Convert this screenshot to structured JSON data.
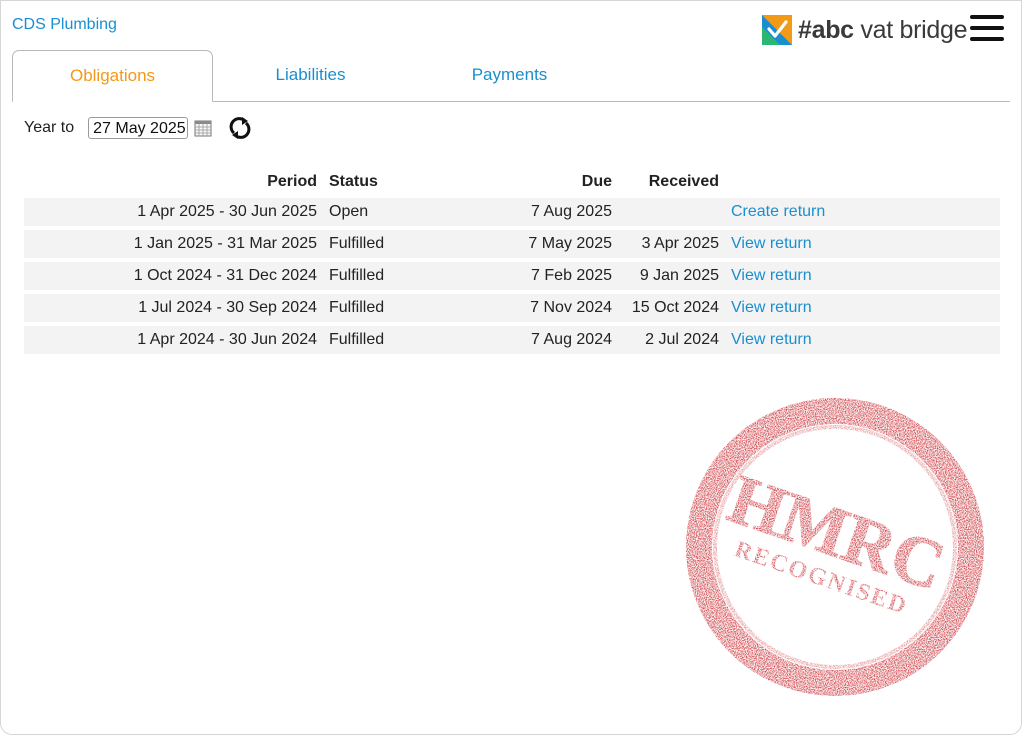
{
  "header": {
    "company": "CDS Plumbing",
    "logo": {
      "hash": "#",
      "abc": "abc",
      "rest": " vat bridge"
    },
    "menu_icon": "hamburger-menu-icon"
  },
  "tabs": [
    {
      "label": "Obligations",
      "active": true
    },
    {
      "label": "Liabilities",
      "active": false
    },
    {
      "label": "Payments",
      "active": false
    }
  ],
  "filter": {
    "year_label": "Year to",
    "year_value": "27 May 2025",
    "calendar_icon": "calendar-icon",
    "refresh_icon": "refresh-icon"
  },
  "table": {
    "columns": [
      "Period",
      "Status",
      "Due",
      "Received",
      ""
    ],
    "rows": [
      {
        "period": "1 Apr 2025 - 30 Jun 2025",
        "status": "Open",
        "due": "7 Aug 2025",
        "received": "",
        "action": "Create return"
      },
      {
        "period": "1 Jan 2025 - 31 Mar 2025",
        "status": "Fulfilled",
        "due": "7 May 2025",
        "received": "3 Apr 2025",
        "action": "View return"
      },
      {
        "period": "1 Oct 2024 - 31 Dec 2024",
        "status": "Fulfilled",
        "due": "7 Feb 2025",
        "received": "9 Jan 2025",
        "action": "View return"
      },
      {
        "period": "1 Jul 2024 - 30 Sep 2024",
        "status": "Fulfilled",
        "due": "7 Nov 2024",
        "received": "15 Oct 2024",
        "action": "View return"
      },
      {
        "period": "1 Apr 2024 - 30 Jun 2024",
        "status": "Fulfilled",
        "due": "7 Aug 2024",
        "received": "2 Jul 2024",
        "action": "View return"
      }
    ]
  },
  "stamp": {
    "line1": "HMRC",
    "line2": "RECOGNISED",
    "color": "#c8242b"
  },
  "colors": {
    "link": "#1a8fd0",
    "active_tab": "#f29a17",
    "row_bg": "#f3f3f3"
  }
}
